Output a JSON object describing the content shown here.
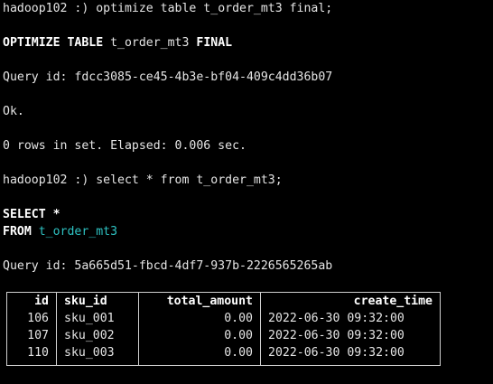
{
  "terminal": {
    "lines": [
      {
        "prompt": "hadoop102 :) ",
        "command": "optimize table t_order_mt3 final;"
      },
      {
        "echo_kw1": "OPTIMIZE TABLE",
        "echo_table": " t_order_mt3 ",
        "echo_kw2": "FINAL"
      },
      {
        "text": "Query id: fdcc3085-ce45-4b3e-bf04-409c4dd36b07"
      },
      {
        "text": "Ok."
      },
      {
        "text": "0 rows in set. Elapsed: 0.006 sec."
      },
      {
        "prompt": "hadoop102 :) ",
        "command": "select * from t_order_mt3;"
      },
      {
        "kw": "SELECT",
        "rest": " *"
      },
      {
        "kw": "FROM",
        "table": " t_order_mt3"
      },
      {
        "text": "Query id: 5a665d51-fbcd-4df7-937b-2226565265ab"
      }
    ]
  },
  "result": {
    "columns": [
      "id",
      "sku_id",
      "total_amount",
      "create_time"
    ],
    "rows": [
      [
        "106",
        "sku_001",
        "0.00",
        "2022-06-30 09:32:00"
      ],
      [
        "107",
        "sku_002",
        "0.00",
        "2022-06-30 09:32:00"
      ],
      [
        "110",
        "sku_003",
        "0.00",
        "2022-06-30 09:32:00"
      ]
    ]
  }
}
